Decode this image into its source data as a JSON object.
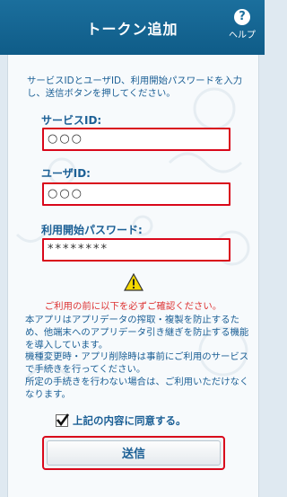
{
  "header": {
    "title": "トークン追加",
    "help_label": "ヘルプ",
    "help_glyph": "?"
  },
  "intro": "サービスIDとユーザID、利用開始パスワードを入力し、送信ボタンを押してください。",
  "fields": {
    "service_id": {
      "label": "サービスID:",
      "value": "○○○"
    },
    "user_id": {
      "label": "ユーザID:",
      "value": "○○○"
    },
    "start_password": {
      "label": "利用開始パスワード:",
      "value": "********"
    }
  },
  "warning": "ご利用の前に以下を必ずご確認ください。",
  "notice": [
    "本アプリはアプリデータの搾取・複製を防止するため、他端末へのアプリデータ引き継ぎを防止する機能を導入しています。",
    "機種変更時・アプリ削除時は事前にご利用のサービスで手続きを行ってください。",
    "所定の手続きを行わない場合は、ご利用いただけなくなります。"
  ],
  "agree": {
    "label": "上記の内容に同意する。",
    "checked": true
  },
  "submit_label": "送信",
  "colors": {
    "accent": "#1b6f9d",
    "highlight": "#d9081b",
    "warning": "#d33"
  }
}
